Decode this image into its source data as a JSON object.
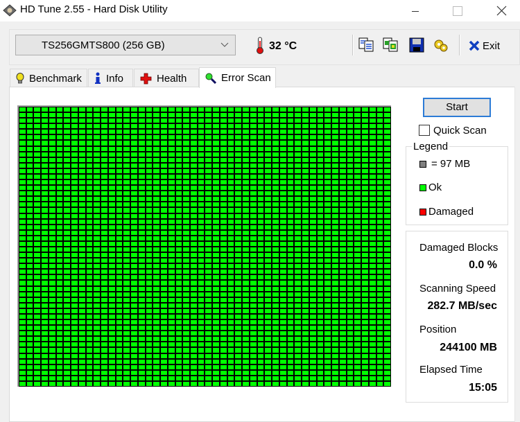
{
  "window": {
    "title": "HD Tune 2.55 - Hard Disk Utility",
    "controls": [
      "minimize",
      "maximize",
      "close"
    ]
  },
  "toolbar": {
    "drive": "TS256GMTS800 (256 GB)",
    "temperature": "32 °C",
    "buttons": [
      {
        "icon": "copy-text-icon",
        "label": "Copy text to clipboard"
      },
      {
        "icon": "copy-screenshot-icon",
        "label": "Copy screenshot to clipboard"
      },
      {
        "icon": "save-icon",
        "label": "Save"
      },
      {
        "icon": "options-icon",
        "label": "Options"
      }
    ],
    "exit_label": "Exit"
  },
  "tabs": [
    {
      "label": "Benchmark",
      "icon": "lightbulb-icon",
      "active": false
    },
    {
      "label": "Info",
      "icon": "info-icon",
      "active": false
    },
    {
      "label": "Health",
      "icon": "health-cross-icon",
      "active": false
    },
    {
      "label": "Error Scan",
      "icon": "magnifier-icon",
      "active": true
    }
  ],
  "error_scan": {
    "grid": {
      "columns": 50,
      "rows": 50,
      "status": "ok"
    },
    "start_label": "Start",
    "quick_scan_label": "Quick Scan",
    "quick_scan_checked": false,
    "legend": {
      "title": "Legend",
      "items": [
        {
          "label": "= 97 MB",
          "color": "#808080"
        },
        {
          "label": "Ok",
          "color": "#00ff00"
        },
        {
          "label": "Damaged",
          "color": "#ff0000"
        }
      ]
    },
    "stats": {
      "damaged_blocks_label": "Damaged Blocks",
      "damaged_blocks_value": "0.0 %",
      "scanning_speed_label": "Scanning Speed",
      "scanning_speed_value": "282.7 MB/sec",
      "position_label": "Position",
      "position_value": "244100 MB",
      "elapsed_time_label": "Elapsed Time",
      "elapsed_time_value": "15:05"
    }
  },
  "colors": {
    "ok": "#00ff00",
    "damaged": "#ff0000",
    "size_block": "#808080",
    "accent": "#2c7bd6"
  }
}
